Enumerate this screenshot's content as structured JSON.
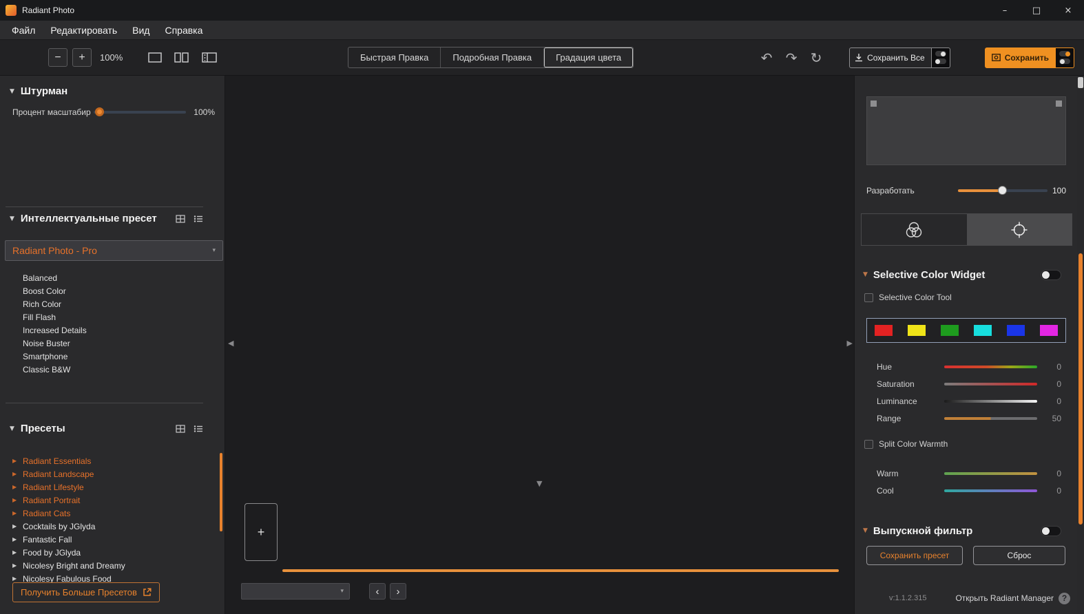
{
  "window": {
    "title": "Radiant Photo"
  },
  "icons": {
    "minimize": "–",
    "maximize": "□",
    "close": "×",
    "undo": "↶",
    "redo": "↷",
    "reset": "↻",
    "caret_down": "▾",
    "triangle_down": "▼",
    "triangle_right": "▶",
    "triangle_left": "◀",
    "chevron_left": "‹",
    "chevron_right": "›",
    "plus": "+",
    "minus": "−",
    "help": "?"
  },
  "colors": {
    "accent_orange": "#e8822d",
    "preset_highlight": "#e8722a",
    "save_button": "#ef9021"
  },
  "menu": {
    "items": [
      "Файл",
      "Редактировать",
      "Вид",
      "Справка"
    ]
  },
  "toolbar": {
    "zoom_level": "100%",
    "tabs": [
      "Быстрая Правка",
      "Подробная Правка",
      "Градация цвета"
    ],
    "active_tab": "Градация цвета",
    "save_all": "Сохранить Все",
    "save": "Сохранить"
  },
  "left_panel": {
    "navigator": {
      "title": "Штурман",
      "zoom_label": "Процент масштабир",
      "zoom_value": "100%"
    },
    "smart_presets": {
      "title": "Интеллектуальные пресет",
      "dropdown_value": "Radiant Photo - Pro",
      "items": [
        "Balanced",
        "Boost Color",
        "Rich Color",
        "Fill Flash",
        "Increased Details",
        "Noise Buster",
        "Smartphone",
        "Classic B&W"
      ]
    },
    "presets": {
      "title": "Пресеты",
      "items": [
        {
          "label": "Radiant Essentials",
          "color": "#e8722a"
        },
        {
          "label": "Radiant Landscape",
          "color": "#e8722a"
        },
        {
          "label": "Radiant Lifestyle",
          "color": "#e8722a"
        },
        {
          "label": "Radiant Portrait",
          "color": "#e8722a"
        },
        {
          "label": "Radiant Cats",
          "color": "#e8722a"
        },
        {
          "label": "Cocktails by JGlyda",
          "color": "#e6e6e6"
        },
        {
          "label": "Fantastic Fall",
          "color": "#e6e6e6"
        },
        {
          "label": "Food by JGlyda",
          "color": "#e6e6e6"
        },
        {
          "label": "Nicolesy Bright and Dreamy",
          "color": "#e6e6e6"
        },
        {
          "label": "Nicolesy Fabulous Food",
          "color": "#e6e6e6"
        }
      ],
      "more_button": "Получить Больше Пресетов"
    }
  },
  "canvas": {
    "add_button": "+",
    "filmstrip_dropdown_value": ""
  },
  "right_panel": {
    "develop_label": "Разработать",
    "develop_value": "100",
    "selective": {
      "title": "Selective Color Widget",
      "tool_label": "Selective Color Tool",
      "swatches": [
        "#e32222",
        "#f0e418",
        "#1e9c1e",
        "#17dede",
        "#1a35e8",
        "#e326e3"
      ],
      "sliders": [
        {
          "label": "Hue",
          "value": "0"
        },
        {
          "label": "Saturation",
          "value": "0"
        },
        {
          "label": "Luminance",
          "value": "0"
        },
        {
          "label": "Range",
          "value": "50"
        }
      ],
      "split_label": "Split Color Warmth",
      "warm_label": "Warm",
      "warm_value": "0",
      "cool_label": "Cool",
      "cool_value": "0"
    },
    "graduated": {
      "title": "Выпускной фильтр",
      "save_preset": "Сохранить пресет",
      "reset": "Сброс"
    },
    "footer": {
      "version": "v:1.1.2.315",
      "manager": "Открыть Radiant Manager"
    }
  }
}
